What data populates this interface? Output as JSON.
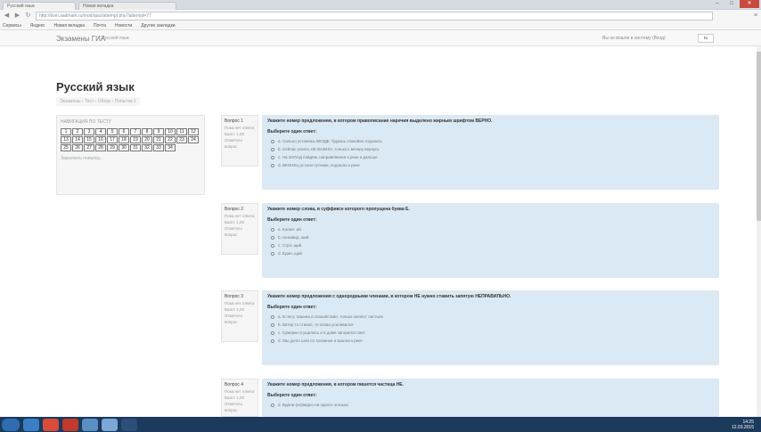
{
  "browser": {
    "tabs": [
      {
        "label": "Русский язык"
      },
      {
        "label": "Новая вкладка"
      }
    ],
    "address": "http://dvm.sadmark.ru/mod/quiz/attempt.php?attempt=77",
    "bookmarks": [
      "Сервисы",
      "Яндекс",
      "Новая вкладка",
      "Почта",
      "Новости",
      "Другие закладки"
    ],
    "window_controls": [
      "–",
      "□",
      "✕"
    ]
  },
  "navbar": {
    "brand": "Экзамены ГИА",
    "link": "Русский язык",
    "login_status": "Вы не вошли в систему (Вход)",
    "language": "ru"
  },
  "page": {
    "title": "Русский язык",
    "breadcrumb": "Экзамены › Тест › Обзор › Попытка 1"
  },
  "quiz_nav": {
    "title": "НАВИГАЦИЯ ПО ТЕСТУ",
    "cells": [
      "1",
      "2",
      "3",
      "4",
      "5",
      "6",
      "7",
      "8",
      "9",
      "10",
      "11",
      "12",
      "13",
      "14",
      "15",
      "16",
      "17",
      "18",
      "19",
      "20",
      "21",
      "22",
      "23",
      "24",
      "25",
      "26",
      "27",
      "28",
      "29",
      "30",
      "31",
      "32",
      "33",
      "34"
    ],
    "finish": "Закончить попытку..."
  },
  "questions": [
    {
      "number": "Вопрос 1",
      "status": "Пока нет ответа",
      "mark": "Балл: 1,00",
      "flag": "Отметить вопрос",
      "text": "Укажите номер предложения, в котором правописание наречия выделено жирным шрифтом ВЕРНО.",
      "prompt": "Выберите один ответ:",
      "options": [
        "а. Сильно устанешь ВЕЗДЕ, будешь спокойно отдыхать",
        "b. Сейчас уехать НЕ ВАЖНО, только к вечеру вернусь",
        "c. На ЗАПАД пойдём, направляемся к реке и дальше",
        "d. ВКОНЕЦ устали путники, подошли к реке"
      ]
    },
    {
      "number": "Вопрос 2",
      "status": "Пока нет ответа",
      "mark": "Балл: 1,00",
      "flag": "Отметить вопрос",
      "text": "Укажите номер слова, в суффиксе которого пропущена буква Е.",
      "prompt": "Выберите один ответ:",
      "options": [
        "а. Колюч..ий",
        "b. Ненавид..ший",
        "c. Стро..щий",
        "d. Един..щий"
      ]
    },
    {
      "number": "Вопрос 3",
      "status": "Пока нет ответа",
      "mark": "Балл: 1,00",
      "flag": "Отметить вопрос",
      "text": "Укажите номер предложения с однородными членами, в котором НЕ нужно ставить запятую НЕПРАВИЛЬНО.",
      "prompt": "Выберите один ответ:",
      "options": [
        "а. В лесу тишина и спокойствие, только шелест листьев",
        "b. Ветер то стихал, то снова усиливался",
        "c. Сумерки сгущались и в доме загорелся свет",
        "d. Мы долго шли по тропинке и вышли к реке"
      ]
    },
    {
      "number": "Вопрос 4",
      "status": "Пока нет ответа",
      "mark": "Балл: 1,00",
      "flag": "Отметить вопрос",
      "text": "Укажите номер предложения, в котором пишется частица НЕ.",
      "prompt": "Выберите один ответ:",
      "options": [
        "а. Вдали (не)видно ни одного огонька"
      ]
    }
  ],
  "taskbar": {
    "time": "14:25",
    "date": "12.03.2015"
  }
}
